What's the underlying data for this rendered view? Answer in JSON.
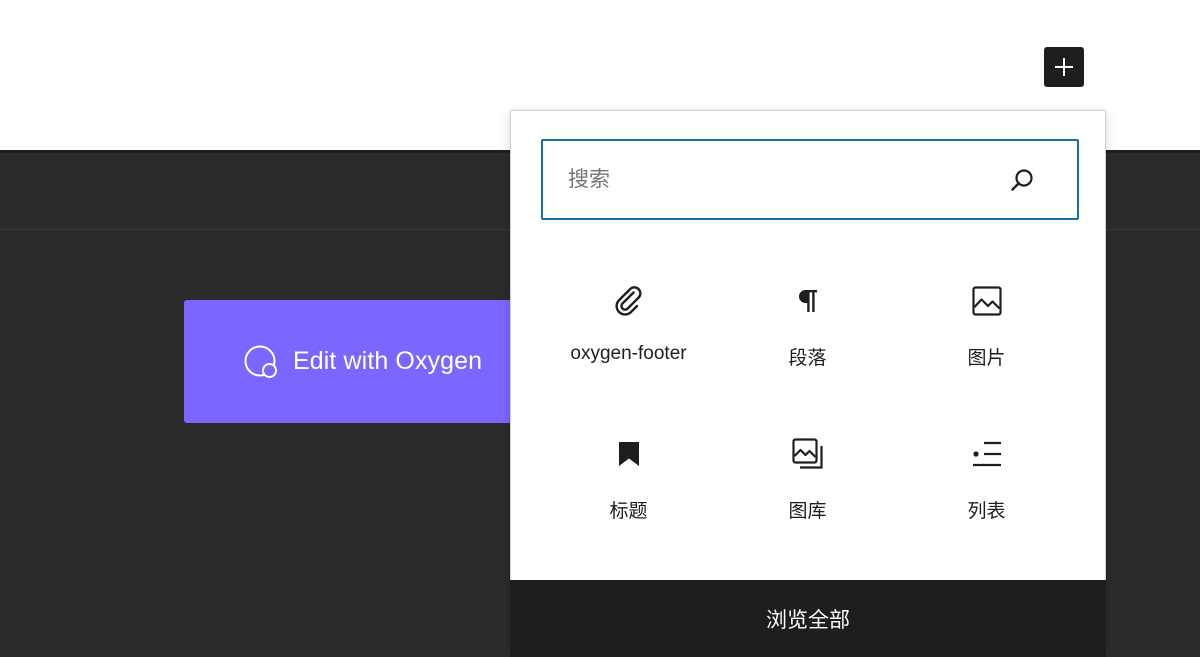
{
  "toolbar": {
    "inserter_icon": "plus-icon"
  },
  "oxygen": {
    "label": "Edit with Oxygen",
    "icon": "oxygen-logo-icon",
    "color": "#7b67ff"
  },
  "inserter": {
    "search": {
      "placeholder": "搜索",
      "value": "",
      "icon": "search-icon"
    },
    "blocks": [
      {
        "label": "oxygen-footer",
        "icon": "paperclip-icon"
      },
      {
        "label": "段落",
        "icon": "paragraph-icon"
      },
      {
        "label": "图片",
        "icon": "image-icon"
      },
      {
        "label": "标题",
        "icon": "bookmark-icon"
      },
      {
        "label": "图库",
        "icon": "gallery-icon"
      },
      {
        "label": "列表",
        "icon": "list-icon"
      }
    ],
    "browse_all": "浏览全部",
    "accent_color": "#1a6ea8"
  },
  "colors": {
    "dark_background": "#2b2b2b",
    "toolbar_dark": "#1e1e1e"
  }
}
